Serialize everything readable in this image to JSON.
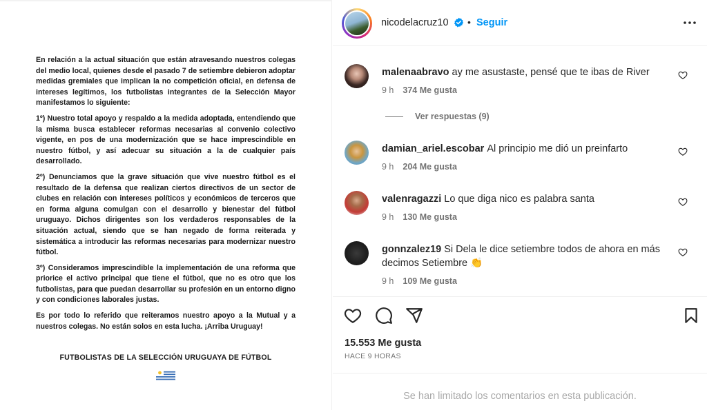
{
  "post": {
    "statement_paragraphs": [
      "En relación a la actual situación que están atravesando nuestros colegas del medio local, quienes desde el pasado 7 de setiembre debieron adoptar medidas gremiales que implican la no competición oficial, en defensa de intereses legítimos, los futbolistas integrantes de la Selección Mayor manifestamos lo siguiente:",
      "1º) Nuestro total apoyo y respaldo a la medida adoptada, entendiendo que la misma busca establecer reformas necesarias al convenio colectivo vigente, en pos de una modernización que se hace imprescindible en nuestro fútbol, y así adecuar su situación a la de cualquier país desarrollado.",
      "2º) Denunciamos que la grave situación que vive nuestro fútbol es el resultado de la defensa que realizan ciertos directivos de un sector de clubes en relación con intereses políticos y económicos de terceros que en forma alguna comulgan con el desarrollo y bienestar del fútbol uruguayo. Dichos dirigentes son los verdaderos responsables de la situación actual, siendo que se han negado de forma reiterada y sistemática a introducir las reformas necesarias para modernizar nuestro fútbol.",
      "3º) Consideramos imprescindible la implementación de una reforma que priorice el activo principal que tiene el fútbol, que no es otro que los futbolistas, para que puedan desarrollar su profesión en un entorno digno y con condiciones laborales justas.",
      "Es por todo lo referido que reiteramos nuestro apoyo a la Mutual y a nuestros colegas. No están solos en esta lucha. ¡Arriba Uruguay!"
    ],
    "signature": "FUTBOLISTAS DE LA SELECCIÓN URUGUAYA DE FÚTBOL"
  },
  "header": {
    "username": "nicodelacruz10",
    "separator": "•",
    "follow_label": "Seguir"
  },
  "comments": [
    {
      "user": "malenaabravo",
      "text": "ay me asustaste, pensé que te ibas de River",
      "time": "9 h",
      "likes": "374 Me gusta"
    },
    {
      "user": "damian_ariel.escobar",
      "text": "Al principio me dió un preinfarto",
      "time": "9 h",
      "likes": "204 Me gusta"
    },
    {
      "user": "valenragazzi",
      "text": "Lo que diga nico es palabra santa",
      "time": "9 h",
      "likes": "130 Me gusta"
    },
    {
      "user": "gonnzalez19",
      "text": "Si Dela le dice setiembre todos de ahora en más decimos Setiembre 👏",
      "time": "9 h",
      "likes": "109 Me gusta"
    }
  ],
  "replies_label": "Ver respuestas (9)",
  "likes_total": "15.553 Me gusta",
  "time_ago": "HACE 9 HORAS",
  "comments_limited": "Se han limitado los comentarios en esta publicación.",
  "colors": {
    "accent": "#0095f6",
    "muted": "#737373",
    "text": "#262626"
  },
  "icons": [
    "more-options-icon",
    "verified-badge-icon",
    "heart-icon",
    "comment-icon",
    "share-icon",
    "bookmark-icon",
    "uruguay-flag"
  ]
}
